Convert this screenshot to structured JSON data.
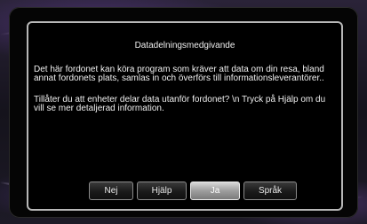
{
  "dialog": {
    "title": "Datadelningsmedgivande",
    "paragraph_1": "Det här fordonet kan köra program som kräver att data om din resa, bland annat fordonets plats, samlas in och överförs till informationsleverantörer..",
    "paragraph_2": "Tillåter du att enheter delar data utanför fordonet? \\n Tryck på Hjälp om du vill se mer detaljerad information."
  },
  "buttons": {
    "no": "Nej",
    "help": "Hjälp",
    "yes": "Ja",
    "language": "Språk",
    "selected": "yes"
  }
}
